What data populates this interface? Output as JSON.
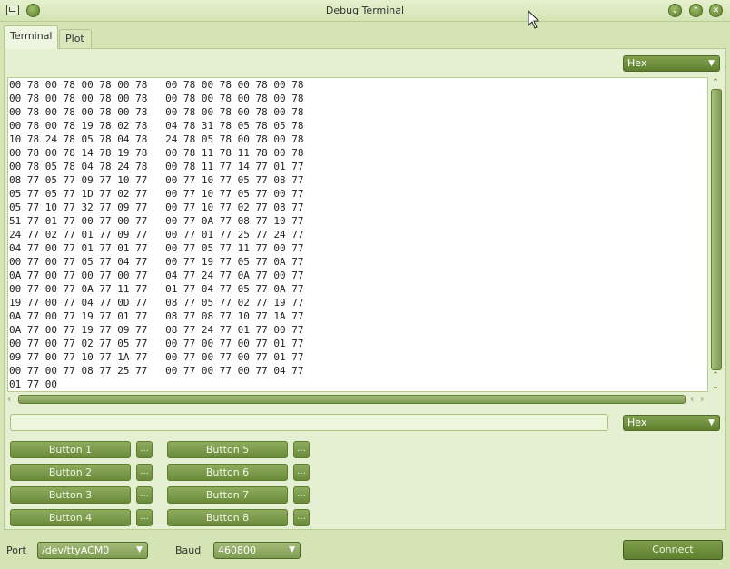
{
  "window": {
    "title": "Debug Terminal"
  },
  "tabs": [
    {
      "label": "Terminal",
      "active": true
    },
    {
      "label": "Plot",
      "active": false
    }
  ],
  "terminal": {
    "view_format": "Hex",
    "lines": [
      "00 78 00 78 00 78 00 78   00 78 00 78 00 78 00 78",
      "00 78 00 78 00 78 00 78   00 78 00 78 00 78 00 78",
      "00 78 00 78 00 78 00 78   00 78 00 78 00 78 00 78",
      "00 78 00 78 19 78 02 78   04 78 31 78 05 78 05 78",
      "10 78 24 78 05 78 04 78   24 78 05 78 00 78 00 78",
      "00 78 00 78 14 78 19 78   00 78 11 78 11 78 00 78",
      "00 78 05 78 04 78 24 78   00 78 11 77 14 77 01 77",
      "08 77 05 77 09 77 10 77   00 77 10 77 05 77 08 77",
      "05 77 05 77 1D 77 02 77   00 77 10 77 05 77 00 77",
      "05 77 10 77 32 77 09 77   00 77 10 77 02 77 08 77",
      "51 77 01 77 00 77 00 77   00 77 0A 77 08 77 10 77",
      "24 77 02 77 01 77 09 77   00 77 01 77 25 77 24 77",
      "04 77 00 77 01 77 01 77   00 77 05 77 11 77 00 77",
      "00 77 00 77 05 77 04 77   00 77 19 77 05 77 0A 77",
      "0A 77 00 77 00 77 00 77   04 77 24 77 0A 77 00 77",
      "00 77 00 77 0A 77 11 77   01 77 04 77 05 77 0A 77",
      "19 77 00 77 04 77 0D 77   08 77 05 77 02 77 19 77",
      "0A 77 00 77 19 77 01 77   08 77 08 77 10 77 1A 77",
      "0A 77 00 77 19 77 09 77   08 77 24 77 01 77 00 77",
      "00 77 00 77 02 77 05 77   00 77 00 77 00 77 01 77",
      "09 77 00 77 10 77 1A 77   00 77 00 77 00 77 01 77",
      "00 77 00 77 08 77 25 77   00 77 00 77 00 77 04 77",
      "01 77 00"
    ]
  },
  "send": {
    "value": "",
    "format": "Hex"
  },
  "buttons": [
    {
      "label": "Button 1",
      "more": "..."
    },
    {
      "label": "Button 2",
      "more": "..."
    },
    {
      "label": "Button 3",
      "more": "..."
    },
    {
      "label": "Button 4",
      "more": "..."
    },
    {
      "label": "Button 5",
      "more": "..."
    },
    {
      "label": "Button 6",
      "more": "..."
    },
    {
      "label": "Button 7",
      "more": "..."
    },
    {
      "label": "Button 8",
      "more": "..."
    }
  ],
  "connection": {
    "port_label": "Port",
    "port": "/dev/ttyACM0",
    "baud_label": "Baud",
    "baud": "460800",
    "connect_label": "Connect"
  },
  "icons": {
    "menu": "menu-circle-icon",
    "minimize": "minimize-icon",
    "maximize": "maximize-icon",
    "close": "close-icon",
    "dropdown": "chevron-down-icon"
  },
  "colors": {
    "accent": "#6a8a3a",
    "background": "#d4e4b4",
    "panel": "#e5efd1"
  }
}
